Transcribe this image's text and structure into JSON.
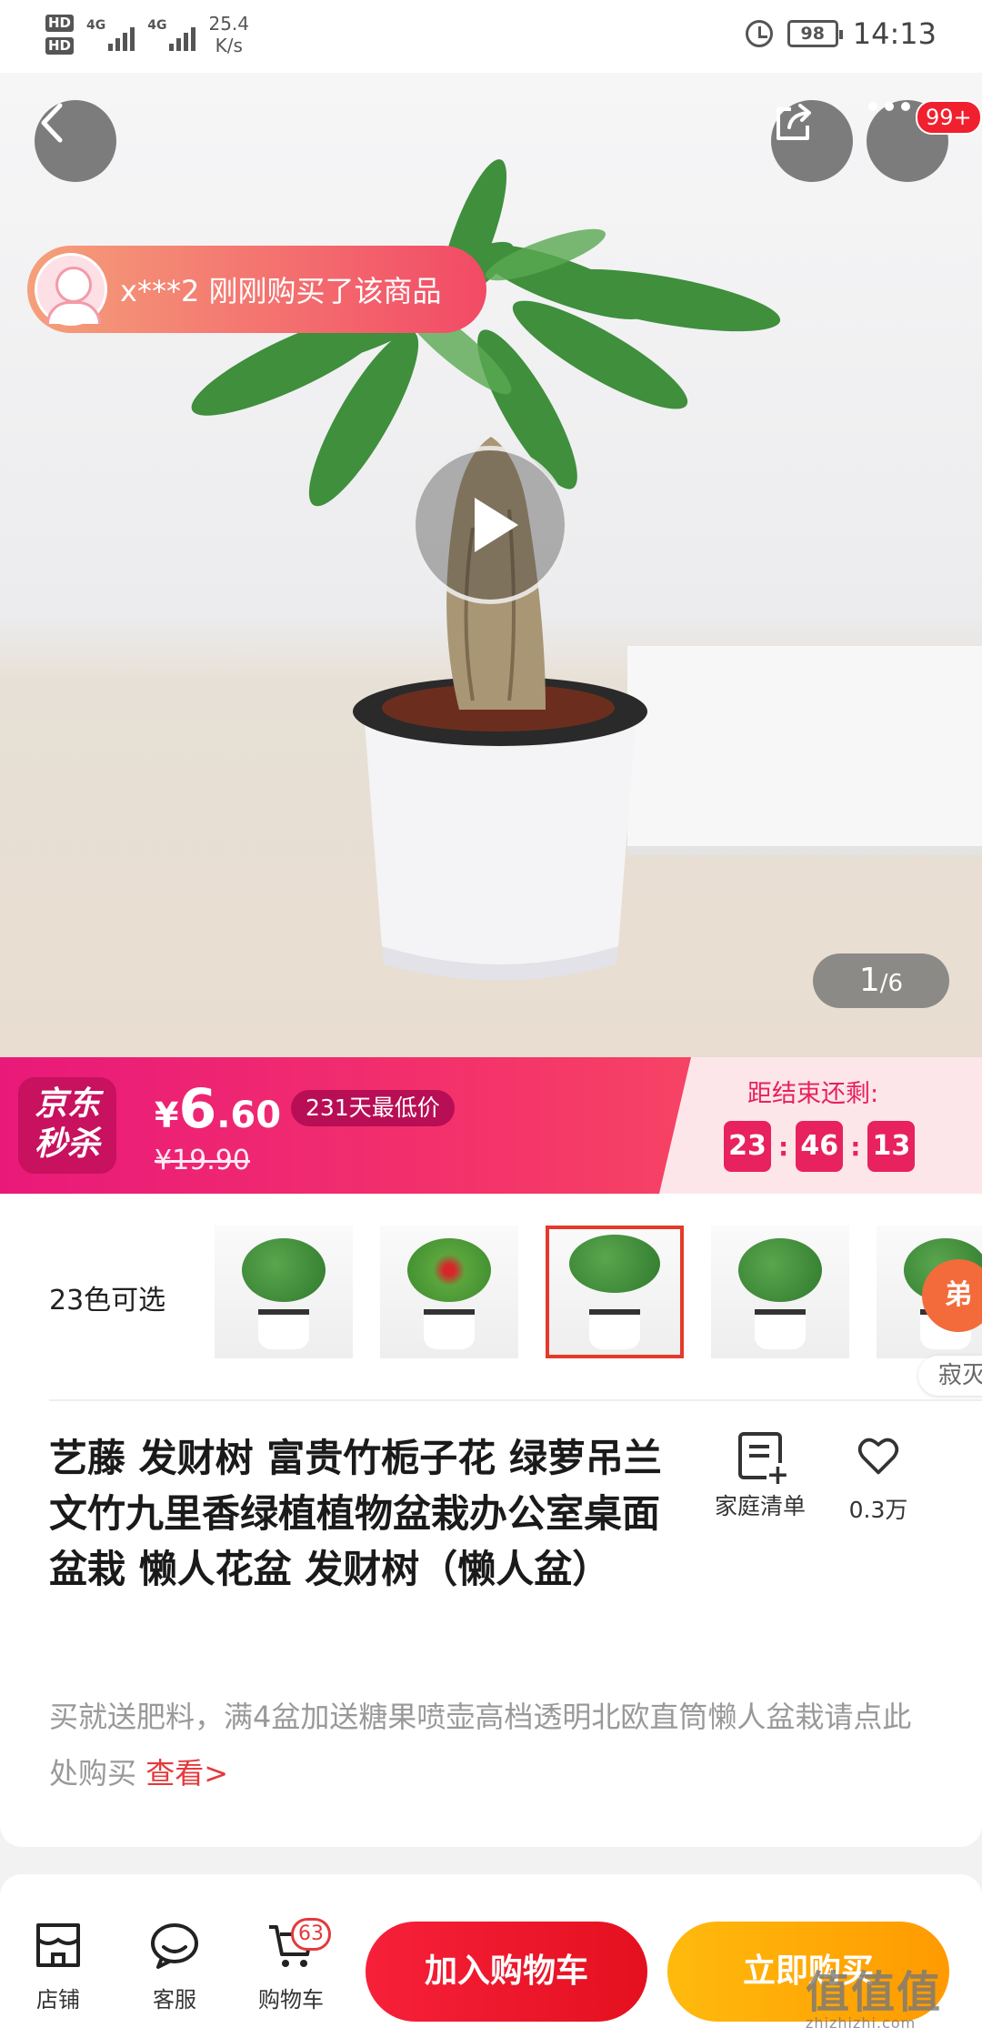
{
  "status_bar": {
    "sim1": "HD",
    "sim2": "HD",
    "net1": "4G",
    "net2": "4G",
    "speed_value": "25.4",
    "speed_unit": "K/s",
    "battery": "98",
    "time": "14:13"
  },
  "hero": {
    "more_badge": "99+",
    "recent_purchase": "x***2 刚刚购买了该商品",
    "page_current": "1",
    "page_total": "/6"
  },
  "seckill": {
    "logo_line1": "京东",
    "logo_line2": "秒杀",
    "price_symbol": "¥",
    "price_int": "6",
    "price_dec": ".60",
    "lowest_tag": "231天最低价",
    "old_price": "¥19.90",
    "countdown_label": "距结束还剩:",
    "hours": "23",
    "minutes": "46",
    "seconds": "13"
  },
  "variants": {
    "count_label": "23色可选",
    "side_chip": "弟",
    "side_text": "寂灭"
  },
  "product": {
    "title": "艺藤  发财树 富贵竹栀子花 绿萝吊兰文竹九里香绿植植物盆栽办公室桌面盆栽   懒人花盆 发财树（懒人盆）",
    "list_label": "家庭清单",
    "favorites": "0.3万",
    "subtitle_text": "买就送肥料，满4盆加送糖果喷壶高档透明北欧直筒懒人盆栽请点此处购买 ",
    "subtitle_link": "查看>"
  },
  "bottom_bar": {
    "store": "店铺",
    "service": "客服",
    "cart": "购物车",
    "cart_count": "63",
    "add_to_cart": "加入购物车",
    "buy_now": "立即购买"
  },
  "watermark": {
    "mark": "值值值",
    "site": "zhizhizhi.com"
  },
  "colors": {
    "seckill": "#f4336a",
    "add_to_cart": "#e4101f",
    "buy_now": "#ff9a00",
    "link": "#e4393c"
  }
}
